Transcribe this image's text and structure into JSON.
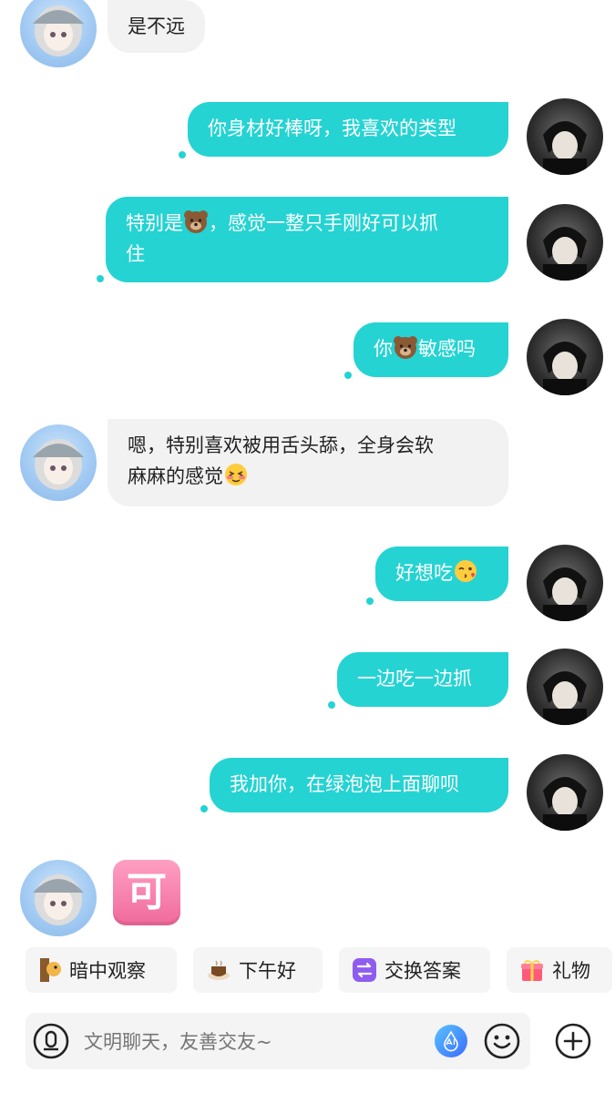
{
  "messages": [
    {
      "side": "left",
      "text": "是不远"
    },
    {
      "side": "right",
      "text": "你身材好棒呀，我喜欢的类型"
    },
    {
      "side": "right",
      "parts": [
        "特别是",
        "，感觉一整只手刚好可以抓",
        "住"
      ]
    },
    {
      "side": "right",
      "parts": [
        "你",
        "敏感吗"
      ]
    },
    {
      "side": "left",
      "parts": [
        "嗯，特别喜欢被用舌头舔，全身会软",
        "麻麻的感觉"
      ]
    },
    {
      "side": "right",
      "text": "好想吃"
    },
    {
      "side": "right",
      "text": "一边吃一边抓"
    },
    {
      "side": "right",
      "text": "我加你，在绿泡泡上面聊呗"
    },
    {
      "side": "left",
      "sticker": "可"
    }
  ],
  "quick_actions": [
    {
      "label": "暗中观察",
      "icon": "peek-dog-icon"
    },
    {
      "label": "下午好",
      "icon": "coffee-icon"
    },
    {
      "label": "交换答案",
      "icon": "exchange-icon"
    },
    {
      "label": "礼物",
      "icon": "gift-icon"
    }
  ],
  "composer": {
    "placeholder": "文明聊天，友善交友~"
  },
  "colors": {
    "accent": "#25d3d3",
    "incoming_bubble": "#f2f2f3"
  }
}
